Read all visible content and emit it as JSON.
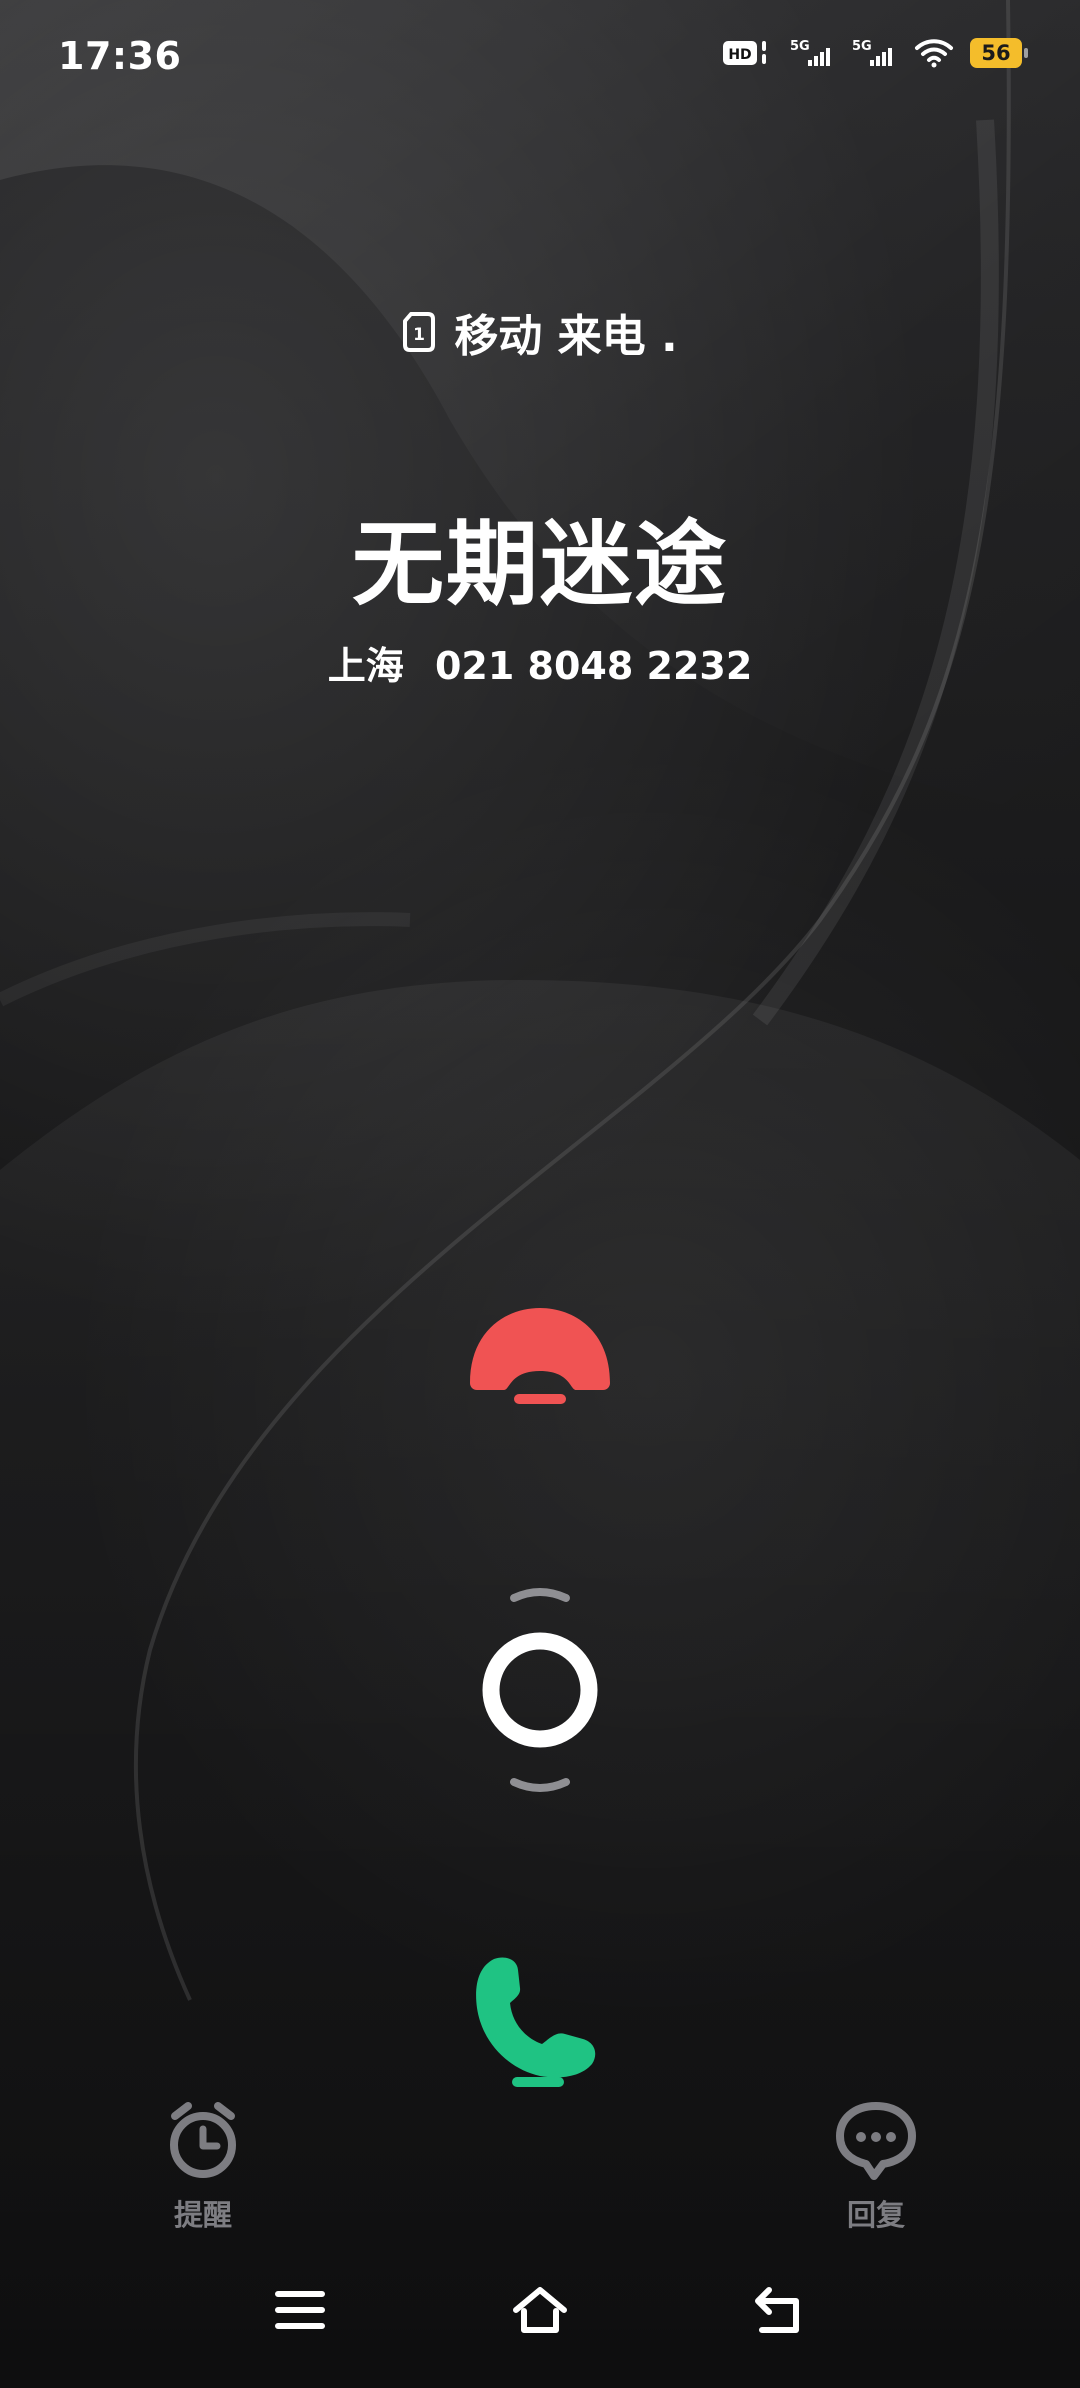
{
  "status_bar": {
    "time": "17:36",
    "hd_label": "HD",
    "signal_label": "5G",
    "battery_level": "56"
  },
  "call": {
    "sim_slot": "1",
    "carrier_label": "移动 来电 .",
    "caller_name": "无期迷途",
    "caller_location": "上海",
    "caller_number": "021 8048 2232"
  },
  "actions": {
    "remind_label": "提醒",
    "reply_label": "回复"
  },
  "colors": {
    "decline": "#f05353",
    "answer": "#1fc383",
    "battery": "#f4bd2b",
    "label_gray": "#7d7d82"
  },
  "icons": {
    "status": [
      "hd-icon",
      "5g-signal-icon",
      "5g-signal-icon",
      "wifi-icon",
      "battery-icon"
    ],
    "call": [
      "sim-card-icon",
      "decline-phone-icon",
      "slider-ring-icon",
      "answer-phone-icon"
    ],
    "actions": [
      "alarm-clock-icon",
      "message-bubble-icon"
    ],
    "navigation": [
      "menu-icon",
      "home-icon",
      "back-icon"
    ]
  }
}
